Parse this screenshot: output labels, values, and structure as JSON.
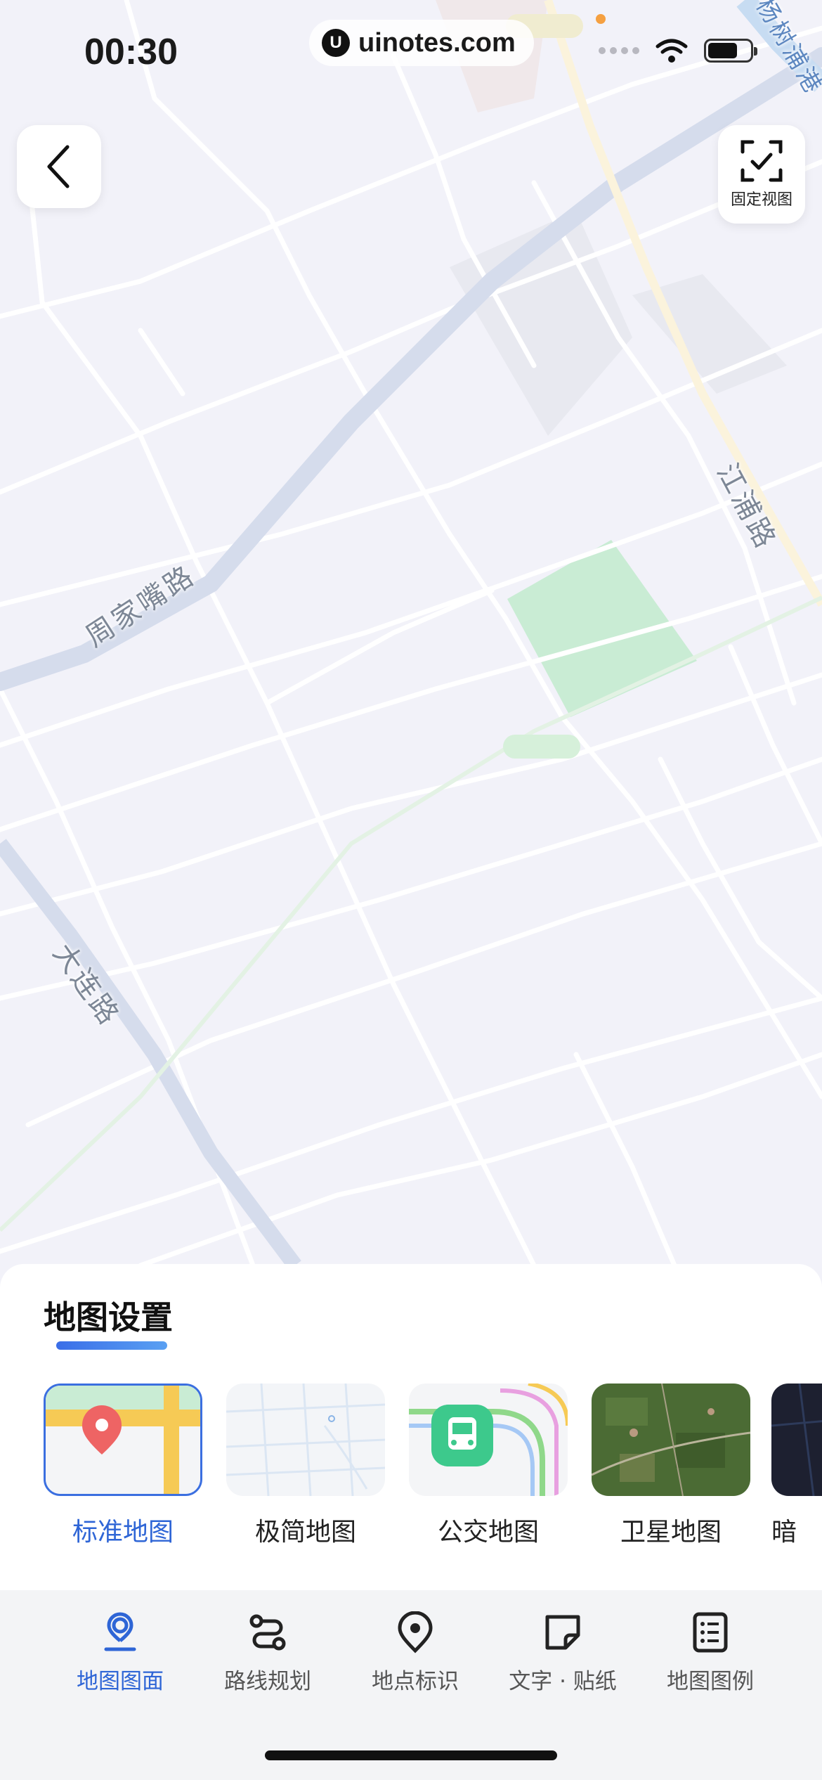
{
  "status_bar": {
    "time": "00:30",
    "watermark": "uinotes.com",
    "battery_level": 0.7
  },
  "map": {
    "road_labels": [
      "周家嘴路",
      "大连路",
      "江浦路",
      "杨树浦港"
    ],
    "fix_view_label": "固定视图",
    "colors": {
      "background": "#f2f2f9",
      "road": "#ffffff",
      "major_road": "#d5dcec",
      "park": "#c9ecd4"
    }
  },
  "sheet": {
    "title": "地图设置",
    "styles": [
      {
        "label": "标准地图",
        "selected": true
      },
      {
        "label": "极简地图",
        "selected": false
      },
      {
        "label": "公交地图",
        "selected": false
      },
      {
        "label": "卫星地图",
        "selected": false
      },
      {
        "label": "暗",
        "selected": false
      }
    ]
  },
  "tabs": [
    {
      "label": "地图图面",
      "icon": "map-pin-person-icon",
      "active": true
    },
    {
      "label": "路线规划",
      "icon": "route-icon",
      "active": false
    },
    {
      "label": "地点标识",
      "icon": "location-pin-icon",
      "active": false
    },
    {
      "label": "文字 · 贴纸",
      "icon": "sticker-icon",
      "active": false
    },
    {
      "label": "地图图例",
      "icon": "legend-list-icon",
      "active": false
    }
  ],
  "accent_color": "#2e65d6"
}
